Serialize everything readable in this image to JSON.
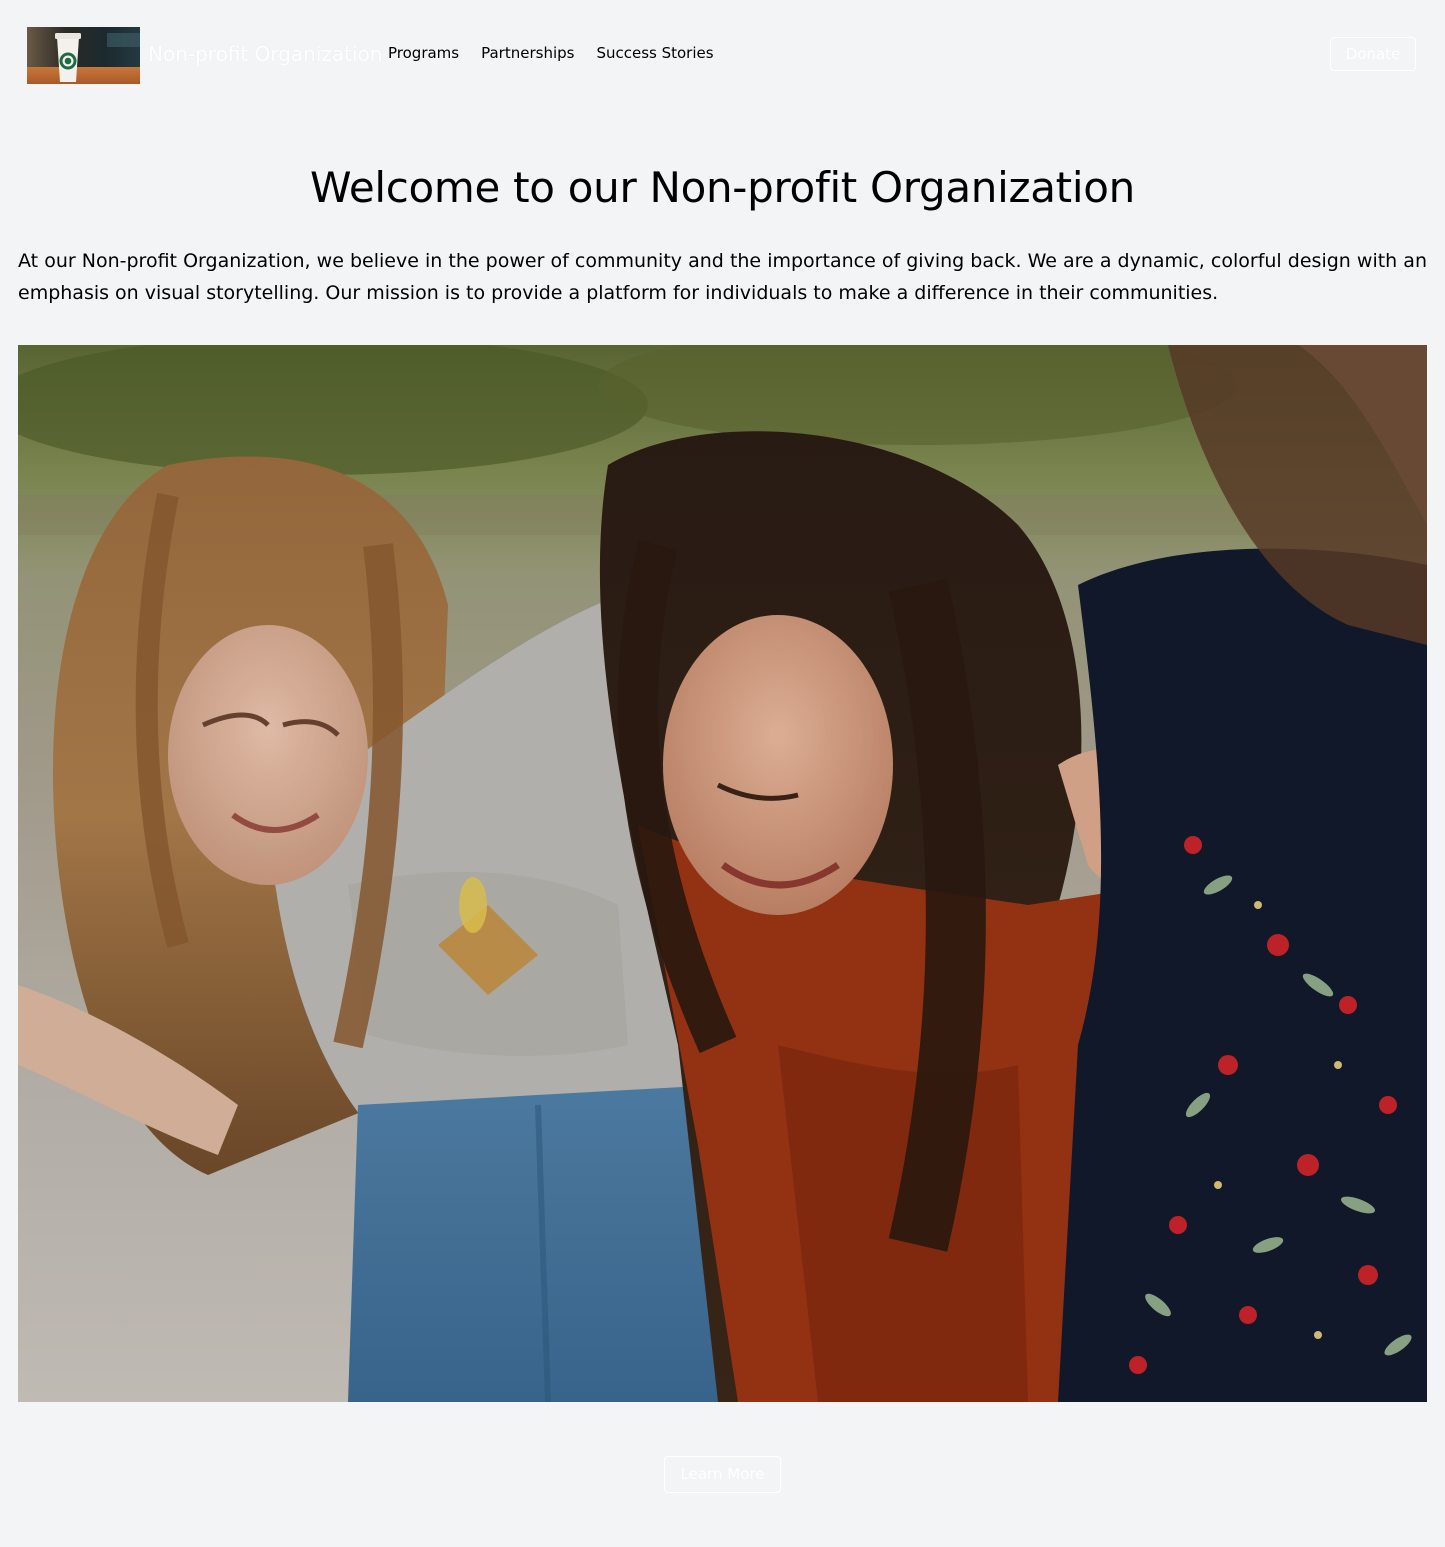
{
  "header": {
    "brand": "Non-profit Organization",
    "logo_icon": "coffee-cup-logo",
    "nav": [
      {
        "label": "Programs"
      },
      {
        "label": "Partnerships"
      },
      {
        "label": "Success Stories"
      }
    ],
    "donate_label": "Donate"
  },
  "hero": {
    "title": "Welcome to our Non-profit Organization",
    "text": "At our Non-profit Organization, we believe in the power of community and the importance of giving back. We are a dynamic, colorful design with an emphasis on visual storytelling. Our mission is to provide a platform for individuals to make a difference in their communities.",
    "image_icon": "friends-photo"
  },
  "cta": {
    "learn_more_label": "Learn More"
  },
  "colors": {
    "background": "#f3f4f6",
    "text": "#000000",
    "button_outline": "#ffffff"
  }
}
